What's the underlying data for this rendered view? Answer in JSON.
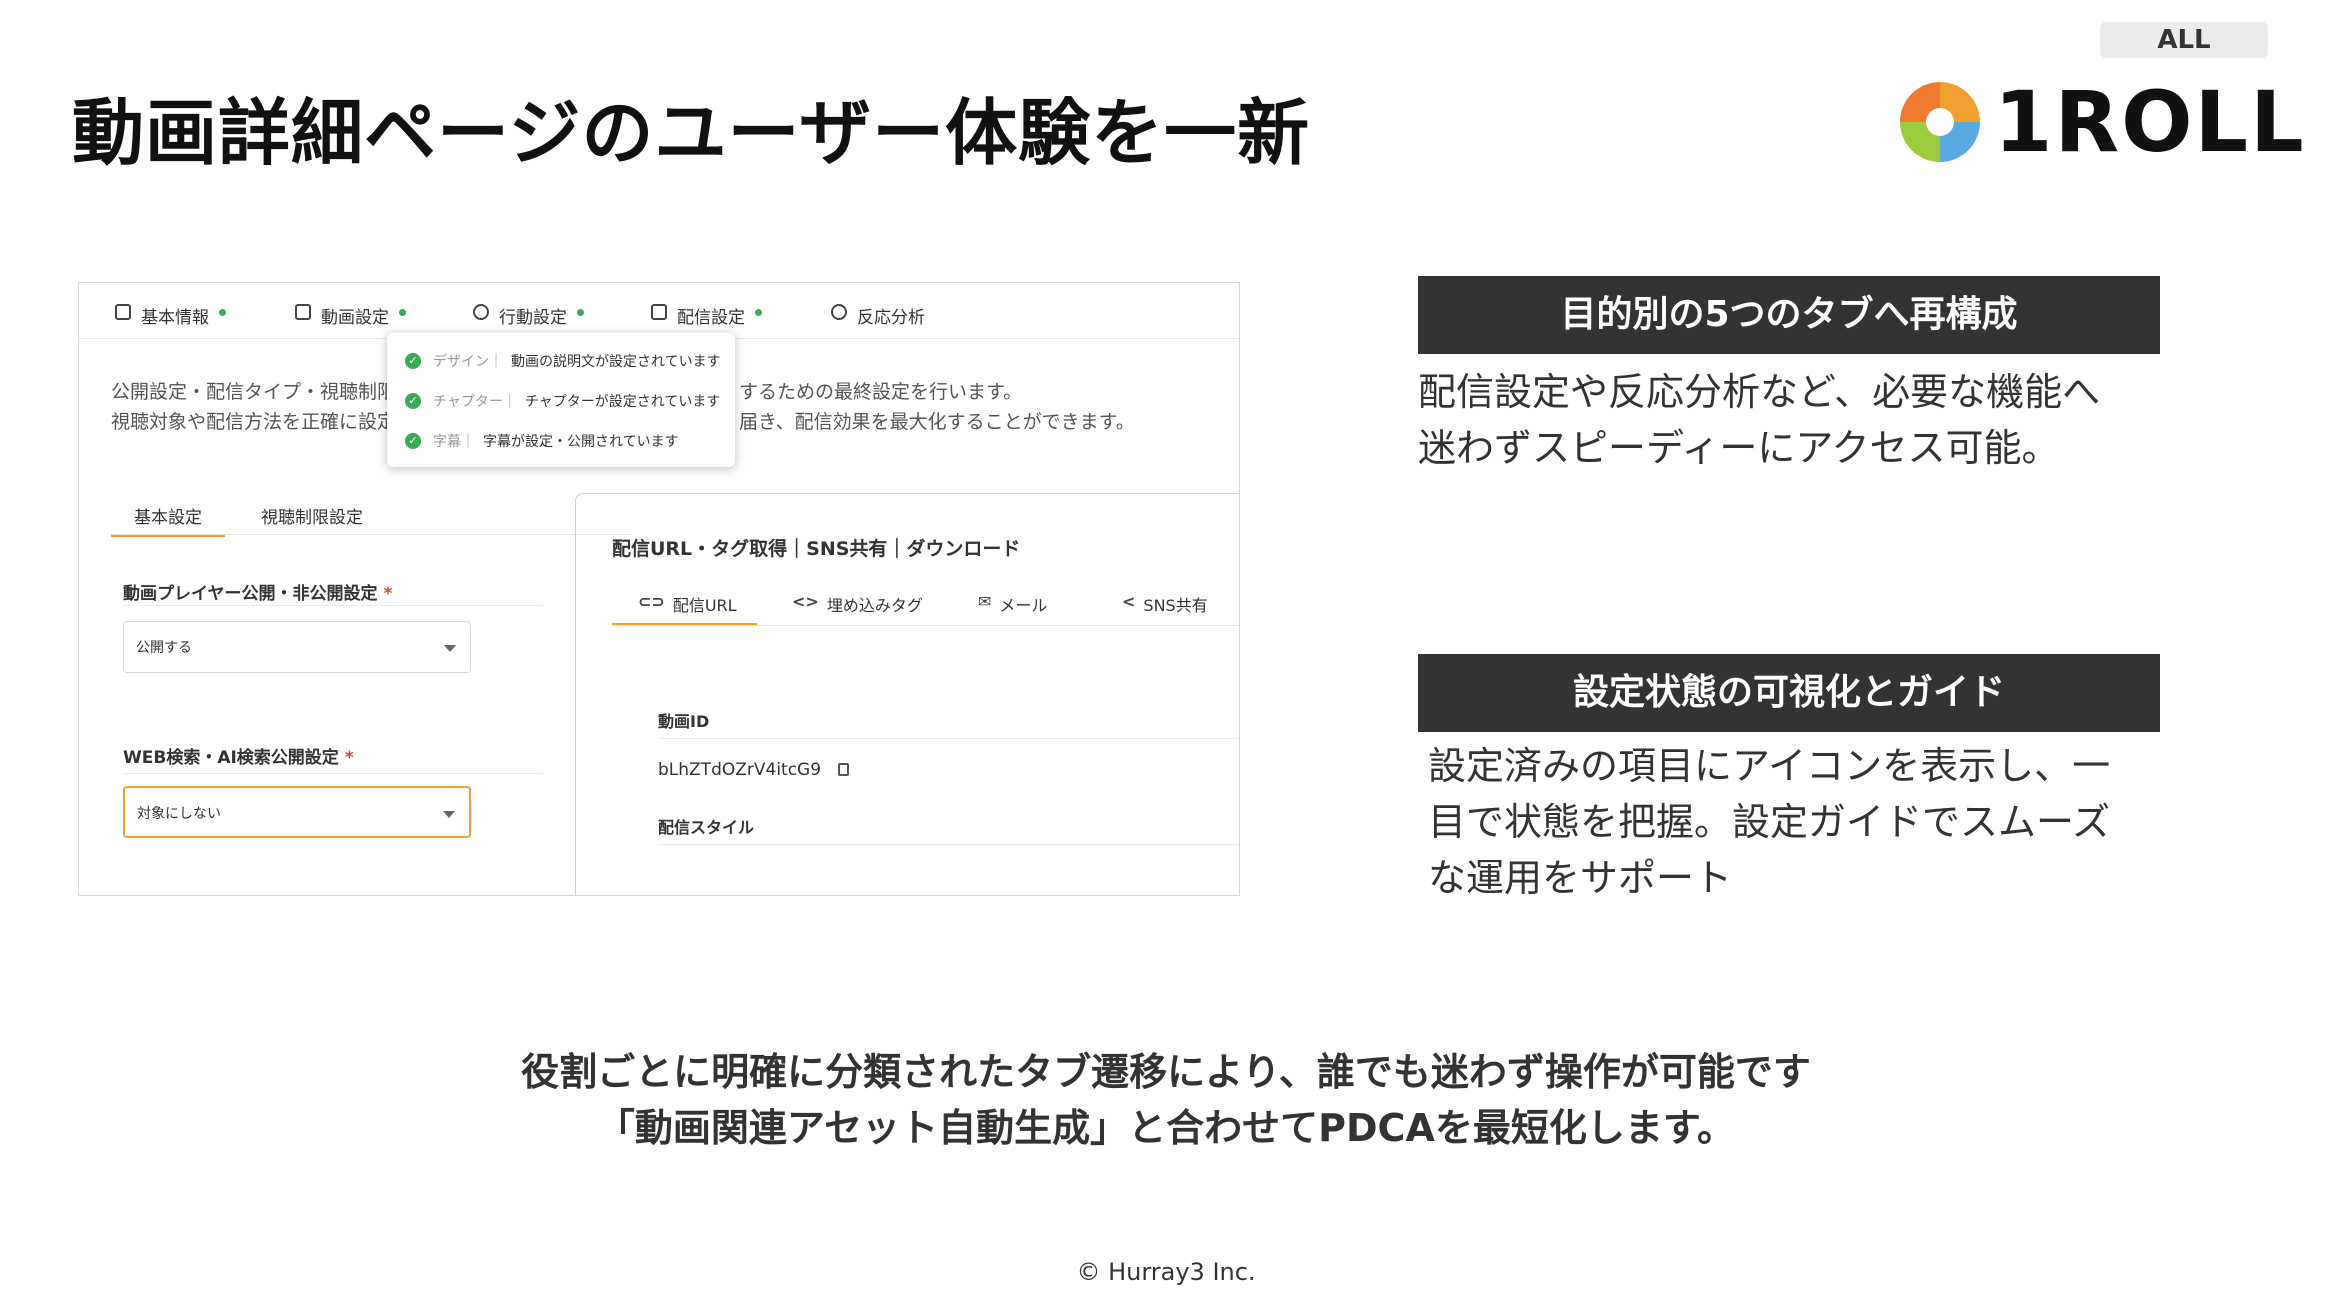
{
  "badge": "ALL",
  "title": "動画詳細ページのユーザー体験を一新",
  "logo": {
    "text": "1ROLL",
    "colors": [
      "#f0a030",
      "#5aa8e0",
      "#9ccc3c",
      "#f07a30"
    ]
  },
  "screenshot": {
    "tabs": [
      {
        "label": "基本情報",
        "icon": "document-icon",
        "status": true
      },
      {
        "label": "動画設定",
        "icon": "video-settings-icon",
        "status": true
      },
      {
        "label": "行動設定",
        "icon": "pointer-icon",
        "status": true
      },
      {
        "label": "配信設定",
        "icon": "cast-icon",
        "status": true
      },
      {
        "label": "反応分析",
        "icon": "smile-icon",
        "status": false
      }
    ],
    "description": [
      "公開設定・配信タイプ・視聴制限",
      "視聴対象や配信方法を正確に設定",
      "するための最終設定を行います。",
      "届き、配信効果を最大化することができます。"
    ],
    "popup": [
      {
        "key": "デザイン｜",
        "value": "動画の説明文が設定されています"
      },
      {
        "key": "チャプター｜",
        "value": "チャプターが設定されています"
      },
      {
        "key": "字幕｜",
        "value": "字幕が設定・公開されています"
      }
    ],
    "subtabs": [
      "基本設定",
      "視聴制限設定"
    ],
    "fields": [
      {
        "label": "動画プレイヤー公開・非公開設定",
        "required": "*",
        "value": "公開する"
      },
      {
        "label": "WEB検索・AI検索公開設定",
        "required": "*",
        "value": "対象にしない"
      }
    ],
    "card": {
      "title": "配信URL・タグ取得｜SNS共有｜ダウンロード",
      "tabs": [
        {
          "label": "配信URL",
          "glyph": "⊂⊃"
        },
        {
          "label": "埋め込みタグ",
          "glyph": "<>"
        },
        {
          "label": "メール",
          "glyph": "✉"
        },
        {
          "label": "SNS共有",
          "glyph": "<"
        }
      ],
      "video_id_label": "動画ID",
      "video_id": "bLhZTdOZrV4itcG9",
      "style_label": "配信スタイル"
    }
  },
  "features": [
    {
      "heading": "目的別の5つのタブへ再構成",
      "body": [
        "配信設定や反応分析など、必要な機能へ",
        "迷わずスピーディーにアクセス可能。"
      ]
    },
    {
      "heading": "設定状態の可視化とガイド",
      "body": [
        "設定済みの項目にアイコンを表示し、一",
        "目で状態を把握。設定ガイドでスムーズ",
        "な運用をサポート"
      ]
    }
  ],
  "summary": [
    "役割ごとに明確に分類されたタブ遷移により、誰でも迷わず操作が可能です",
    "「動画関連アセット自動生成」と合わせてPDCAを最短化します。"
  ],
  "footer": "© Hurray3 Inc."
}
